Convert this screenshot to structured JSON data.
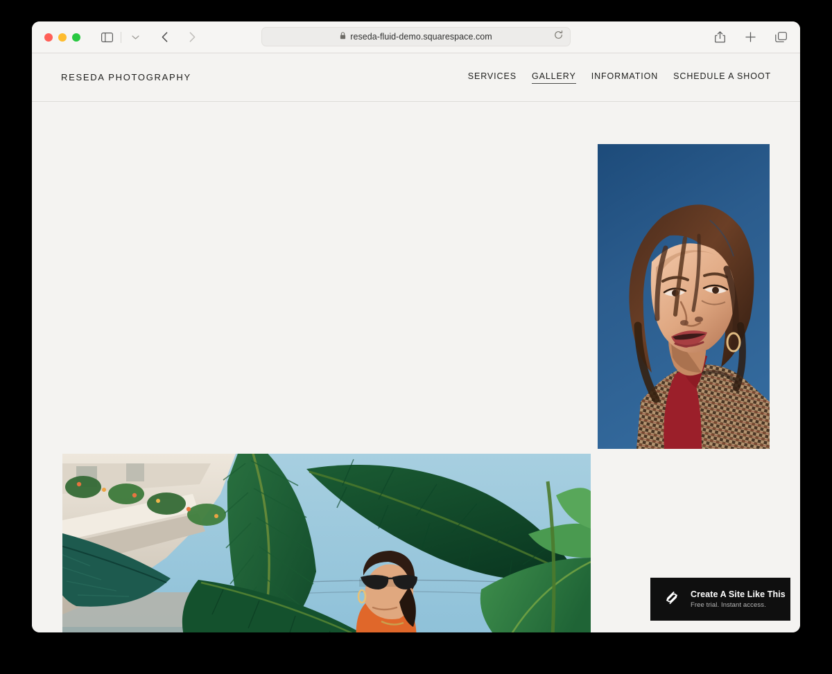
{
  "browser": {
    "traffic_lights": [
      "close",
      "minimize",
      "zoom"
    ],
    "sidebar_icon": "sidebar-icon",
    "tab_group_chevron": "chevron-down-icon",
    "back_icon": "chevron-left-icon",
    "forward_icon": "chevron-right-icon",
    "address": {
      "lock_icon": "lock-icon",
      "url": "reseda-fluid-demo.squarespace.com",
      "reload_icon": "reload-icon"
    },
    "share_icon": "share-icon",
    "new_tab_icon": "plus-icon",
    "tab_overview_icon": "tab-overview-icon"
  },
  "site": {
    "brand": "RESEDA PHOTOGRAPHY",
    "nav": [
      {
        "label": "SERVICES",
        "active": false
      },
      {
        "label": "GALLERY",
        "active": true
      },
      {
        "label": "INFORMATION",
        "active": false
      },
      {
        "label": "SCHEDULE A SHOOT",
        "active": false
      }
    ],
    "gallery": [
      {
        "name": "portrait-sky",
        "alt": "Woman looking upward against a deep blue sky wearing a red turtleneck and houndstooth blazer"
      },
      {
        "name": "banana-leaves",
        "alt": "Woman in orange top with sunglasses under large banana leaves against a pale blue sky"
      }
    ]
  },
  "promo": {
    "title": "Create A Site Like This",
    "subtitle": "Free trial. Instant access.",
    "logo_icon": "squarespace-logo-icon"
  },
  "colors": {
    "page_bg": "#f4f3f1",
    "toolbar_bg": "#f6f5f3",
    "text": "#1d1d1b",
    "promo_bg": "#0f0f0f",
    "sky_blue": "#2c5d8f",
    "leaf_green": "#1d5c34"
  }
}
